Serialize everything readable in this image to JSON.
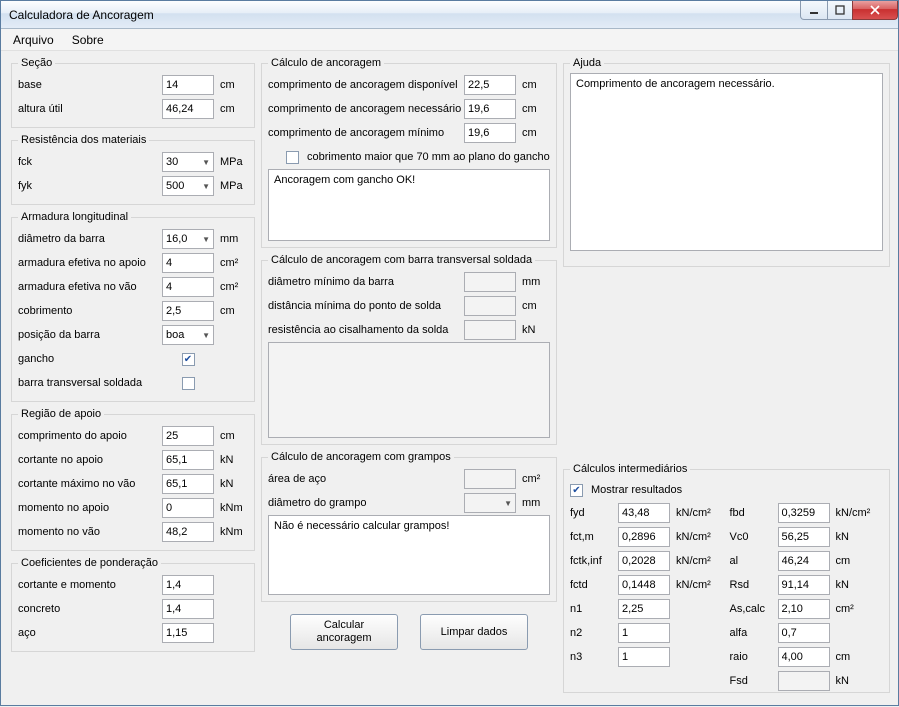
{
  "window": {
    "title": "Calculadora de Ancoragem"
  },
  "menu": {
    "file": "Arquivo",
    "about": "Sobre"
  },
  "section": {
    "legend": "Seção",
    "base_label": "base",
    "base": "14",
    "base_unit": "cm",
    "height_label": "altura útil",
    "height": "46,24",
    "height_unit": "cm"
  },
  "materials": {
    "legend": "Resistência dos materiais",
    "fck_label": "fck",
    "fck": "30",
    "fck_unit": "MPa",
    "fyk_label": "fyk",
    "fyk": "500",
    "fyk_unit": "MPa"
  },
  "long_arm": {
    "legend": "Armadura longitudinal",
    "diam_label": "diâmetro da barra",
    "diam": "16,0",
    "diam_unit": "mm",
    "aeff_ap_label": "armadura efetiva no apoio",
    "aeff_ap": "4",
    "aeff_ap_unit": "cm²",
    "aeff_vao_label": "armadura efetiva no vão",
    "aeff_vao": "4",
    "aeff_vao_unit": "cm²",
    "cobr_label": "cobrimento",
    "cobr": "2,5",
    "cobr_unit": "cm",
    "pos_label": "posição da barra",
    "pos": "boa",
    "gancho_label": "gancho",
    "gancho_checked": true,
    "barra_trans_label": "barra transversal soldada",
    "barra_trans_checked": false
  },
  "support": {
    "legend": "Região de apoio",
    "comp_label": "comprimento do apoio",
    "comp": "25",
    "comp_unit": "cm",
    "cort_ap_label": "cortante no apoio",
    "cort_ap": "65,1",
    "cort_ap_unit": "kN",
    "cort_max_label": "cortante máximo no vão",
    "cort_max": "65,1",
    "cort_max_unit": "kN",
    "mom_ap_label": "momento no apoio",
    "mom_ap": "0",
    "mom_ap_unit": "kNm",
    "mom_vao_label": "momento no vão",
    "mom_vao": "48,2",
    "mom_vao_unit": "kNm"
  },
  "coef": {
    "legend": "Coeficientes de ponderação",
    "cm_label": "cortante e momento",
    "cm": "1,4",
    "conc_label": "concreto",
    "conc": "1,4",
    "aco_label": "aço",
    "aco": "1,15"
  },
  "anc": {
    "legend": "Cálculo de ancoragem",
    "disp_label": "comprimento de ancoragem disponível",
    "disp": "22,5",
    "disp_unit": "cm",
    "nec_label": "comprimento de ancoragem necessário",
    "nec": "19,6",
    "nec_unit": "cm",
    "min_label": "comprimento de ancoragem mínimo",
    "min": "19,6",
    "min_unit": "cm",
    "cobr70_label": "cobrimento maior que 70 mm ao plano do gancho",
    "result": "Ancoragem com gancho OK!"
  },
  "trans": {
    "legend": "Cálculo de ancoragem com barra transversal soldada",
    "diam_label": "diâmetro mínimo da barra",
    "diam": "",
    "diam_unit": "mm",
    "dist_label": "distância mínima do ponto de solda",
    "dist": "",
    "dist_unit": "cm",
    "res_label": "resistência ao cisalhamento da solda",
    "res": "",
    "res_unit": "kN",
    "result": ""
  },
  "gramp": {
    "legend": "Cálculo de ancoragem com grampos",
    "area_label": "área de aço",
    "area": "",
    "area_unit": "cm²",
    "diam_label": "diâmetro do grampo",
    "diam": "",
    "diam_unit": "mm",
    "result": "Não é necessário calcular grampos!"
  },
  "buttons": {
    "calc": "Calcular\nancoragem",
    "clear": "Limpar dados"
  },
  "help": {
    "legend": "Ajuda",
    "text": "Comprimento de ancoragem necessário."
  },
  "interm": {
    "legend": "Cálculos intermediários",
    "show_label": "Mostrar resultados",
    "left": {
      "fyd_label": "fyd",
      "fyd": "43,48",
      "fyd_unit": "kN/cm²",
      "fctm_label": "fct,m",
      "fctm": "0,2896",
      "fctm_unit": "kN/cm²",
      "fctk_label": "fctk,inf",
      "fctk": "0,2028",
      "fctk_unit": "kN/cm²",
      "fctd_label": "fctd",
      "fctd": "0,1448",
      "fctd_unit": "kN/cm²",
      "n1_label": "n1",
      "n1": "2,25",
      "n2_label": "n2",
      "n2": "1",
      "n3_label": "n3",
      "n3": "1"
    },
    "right": {
      "fbd_label": "fbd",
      "fbd": "0,3259",
      "fbd_unit": "kN/cm²",
      "vc0_label": "Vc0",
      "vc0": "56,25",
      "vc0_unit": "kN",
      "al_label": "al",
      "al": "46,24",
      "al_unit": "cm",
      "rsd_label": "Rsd",
      "rsd": "91,14",
      "rsd_unit": "kN",
      "ascalc_label": "As,calc",
      "ascalc": "2,10",
      "ascalc_unit": "cm²",
      "alfa_label": "alfa",
      "alfa": "0,7",
      "raio_label": "raio",
      "raio": "4,00",
      "raio_unit": "cm",
      "fsd_label": "Fsd",
      "fsd": "",
      "fsd_unit": "kN"
    }
  }
}
